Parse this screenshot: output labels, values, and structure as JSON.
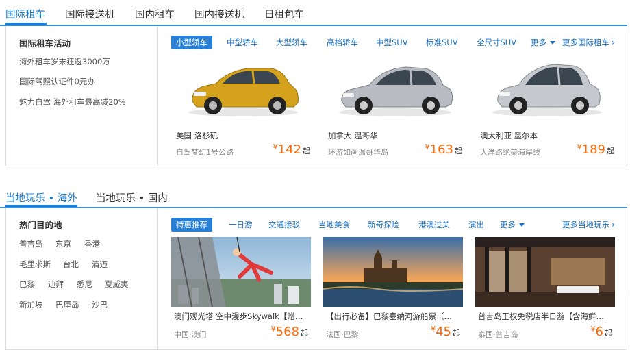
{
  "top_tabs": [
    "国际租车",
    "国际接送机",
    "国内租车",
    "国内接送机",
    "日租包车"
  ],
  "rental": {
    "side_title": "国际租车活动",
    "side_items": [
      "海外租车岁末狂返3000万",
      "国际驾照认证件0元办",
      "魅力自驾 海外租车最高减20%"
    ],
    "categories": [
      "小型轿车",
      "中型轿车",
      "大型轿车",
      "高档轿车",
      "中型SUV",
      "标准SUV",
      "全尺寸SUV"
    ],
    "more_label": "更多",
    "more_link": "更多国际租车",
    "cars": [
      {
        "title": "美国 洛杉矶",
        "sub": "自驾梦幻1号公路",
        "currency": "¥",
        "price": "142",
        "suffix": "起",
        "color": "#d4a21c"
      },
      {
        "title": "加拿大 温哥华",
        "sub": "环游如画温哥华岛",
        "currency": "¥",
        "price": "163",
        "suffix": "起",
        "color": "#b8bcc2"
      },
      {
        "title": "澳大利亚 墨尔本",
        "sub": "大洋路绝美海岸线",
        "currency": "¥",
        "price": "189",
        "suffix": "起",
        "color": "#c5c9ce"
      }
    ]
  },
  "play_tabs": [
    "当地玩乐 • 海外",
    "当地玩乐 • 国内"
  ],
  "play": {
    "side_title": "热门目的地",
    "destinations": [
      [
        "普吉岛",
        "东京",
        "香港"
      ],
      [
        "毛里求斯",
        "台北",
        "清迈"
      ],
      [
        "巴黎",
        "迪拜",
        "悉尼",
        "夏威夷"
      ],
      [
        "新加坡",
        "巴厘岛",
        "沙巴"
      ]
    ],
    "categories": [
      "特惠推荐",
      "一日游",
      "交通接驳",
      "当地美食",
      "新奇探险",
      "港澳过关",
      "演出"
    ],
    "more_label": "更多",
    "more_link": "更多当地玩乐",
    "items": [
      {
        "title": "澳门观光塔 空中漫步Skywalk【赠观光塔门票】",
        "sub": "中国·澳门",
        "currency": "¥",
        "price": "568",
        "suffix": "起"
      },
      {
        "title": "【出行必备】巴黎塞纳河游船票（电子票）",
        "sub": "法国·巴黎",
        "currency": "¥",
        "price": "45",
        "suffix": "起"
      },
      {
        "title": "普吉岛王权免税店半日游【含海鲜自助餐】",
        "sub": "泰国·普吉岛",
        "currency": "¥",
        "price": "6",
        "suffix": "起"
      }
    ]
  }
}
